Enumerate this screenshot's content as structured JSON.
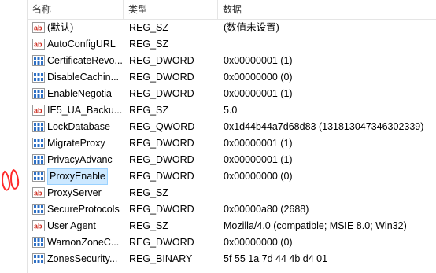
{
  "columns": {
    "name": "名称",
    "type": "类型",
    "data": "数据"
  },
  "rows": [
    {
      "name": "(默认)",
      "type": "REG_SZ",
      "data": "(数值未设置)",
      "icon": "string-value-icon"
    },
    {
      "name": "AutoConfigURL",
      "type": "REG_SZ",
      "data": "",
      "icon": "string-value-icon"
    },
    {
      "name": "CertificateRevo...",
      "type": "REG_DWORD",
      "data": "0x00000001 (1)",
      "icon": "binary-value-icon"
    },
    {
      "name": "DisableCachin...",
      "type": "REG_DWORD",
      "data": "0x00000000 (0)",
      "icon": "binary-value-icon"
    },
    {
      "name": "EnableNegotia",
      "type": "REG_DWORD",
      "data": "0x00000001 (1)",
      "icon": "binary-value-icon"
    },
    {
      "name": "IE5_UA_Backu...",
      "type": "REG_SZ",
      "data": "5.0",
      "icon": "string-value-icon"
    },
    {
      "name": "LockDatabase",
      "type": "REG_QWORD",
      "data": "0x1d44b44a7d68d83 (131813047346302339)",
      "icon": "binary-value-icon"
    },
    {
      "name": "MigrateProxy",
      "type": "REG_DWORD",
      "data": "0x00000001 (1)",
      "icon": "binary-value-icon"
    },
    {
      "name": "PrivacyAdvanc",
      "type": "REG_DWORD",
      "data": "0x00000001 (1)",
      "icon": "binary-value-icon"
    },
    {
      "name": "ProxyEnable",
      "type": "REG_DWORD",
      "data": "0x00000000 (0)",
      "icon": "binary-value-icon",
      "selected": true
    },
    {
      "name": "ProxyServer",
      "type": "REG_SZ",
      "data": "",
      "icon": "string-value-icon"
    },
    {
      "name": "SecureProtocols",
      "type": "REG_DWORD",
      "data": "0x00000a80 (2688)",
      "icon": "binary-value-icon"
    },
    {
      "name": "User Agent",
      "type": "REG_SZ",
      "data": "Mozilla/4.0 (compatible; MSIE 8.0; Win32)",
      "icon": "string-value-icon"
    },
    {
      "name": "WarnonZoneC...",
      "type": "REG_DWORD",
      "data": "0x00000000 (0)",
      "icon": "binary-value-icon"
    },
    {
      "name": "ZonesSecurity...",
      "type": "REG_BINARY",
      "data": "5f 55 1a 7d 44 4b d4 01",
      "icon": "binary-value-icon"
    }
  ],
  "colors": {
    "selection_fill": "#cce8ff",
    "selection_border": "#99d1ff",
    "annotation_red": "#ff2a2a"
  }
}
